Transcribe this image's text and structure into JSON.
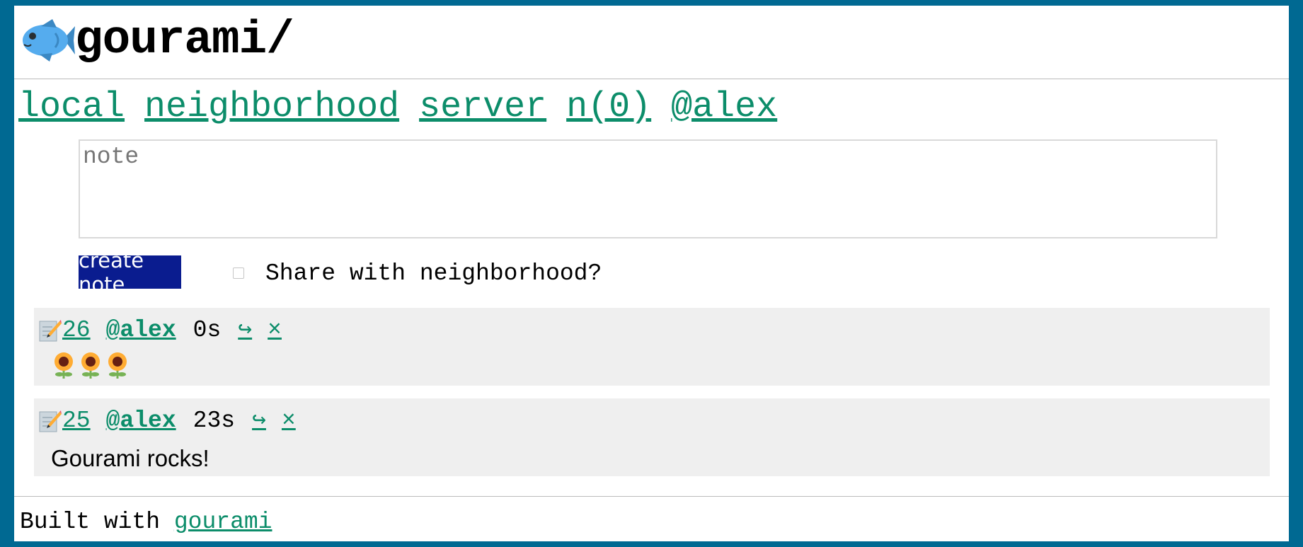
{
  "header": {
    "title": "gourami/"
  },
  "nav": {
    "items": [
      {
        "label": "local"
      },
      {
        "label": "neighborhood"
      },
      {
        "label": "server"
      },
      {
        "label": "n(0)"
      },
      {
        "label": "@alex"
      }
    ]
  },
  "composer": {
    "placeholder": "note",
    "value": "",
    "submit_label": "create note",
    "share_label": "Share with neighborhood?",
    "share_checked": false
  },
  "posts": [
    {
      "id": "26",
      "user": "@alex",
      "time": "0s",
      "reply": "↪",
      "delete": "×",
      "body": "🌻🌻🌻"
    },
    {
      "id": "25",
      "user": "@alex",
      "time": "23s",
      "reply": "↪",
      "delete": "×",
      "body": "Gourami rocks!"
    }
  ],
  "footer": {
    "text": "Built with",
    "link": "gourami"
  },
  "colors": {
    "background": "#006992",
    "link": "#0c8d6a",
    "button": "#0a1c8f",
    "post_bg": "#efefef"
  }
}
